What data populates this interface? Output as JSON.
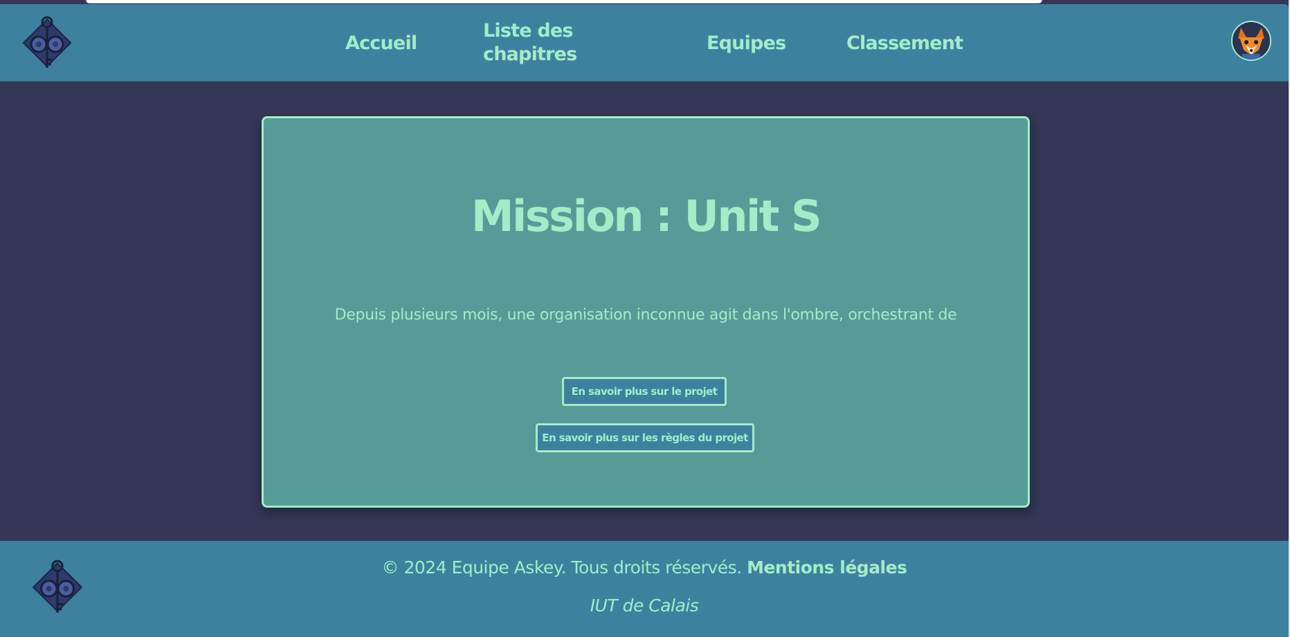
{
  "header": {
    "nav": {
      "accueil": "Accueil",
      "chapitres": "Liste des chapitres",
      "equipes": "Equipes",
      "classement": "Classement"
    },
    "logo_icon": "key-and-gears-logo",
    "avatar_icon": "fox-avatar"
  },
  "mission": {
    "title": "Mission : Unit S",
    "description": "Depuis plusieurs mois, une organisation inconnue agit dans l'ombre, orchestrant de",
    "btn_projet": "En savoir plus sur le projet",
    "btn_regles": "En savoir plus sur les règles du projet"
  },
  "footer": {
    "copyright": "© 2024 Equipe Askey. Tous droits réservés.",
    "legal_link": "Mentions légales",
    "school": "IUT de Calais"
  },
  "colors": {
    "header_bg": "#3e819f",
    "page_bg": "#343755",
    "card_bg": "#579b98",
    "accent": "#a3ecc8"
  }
}
